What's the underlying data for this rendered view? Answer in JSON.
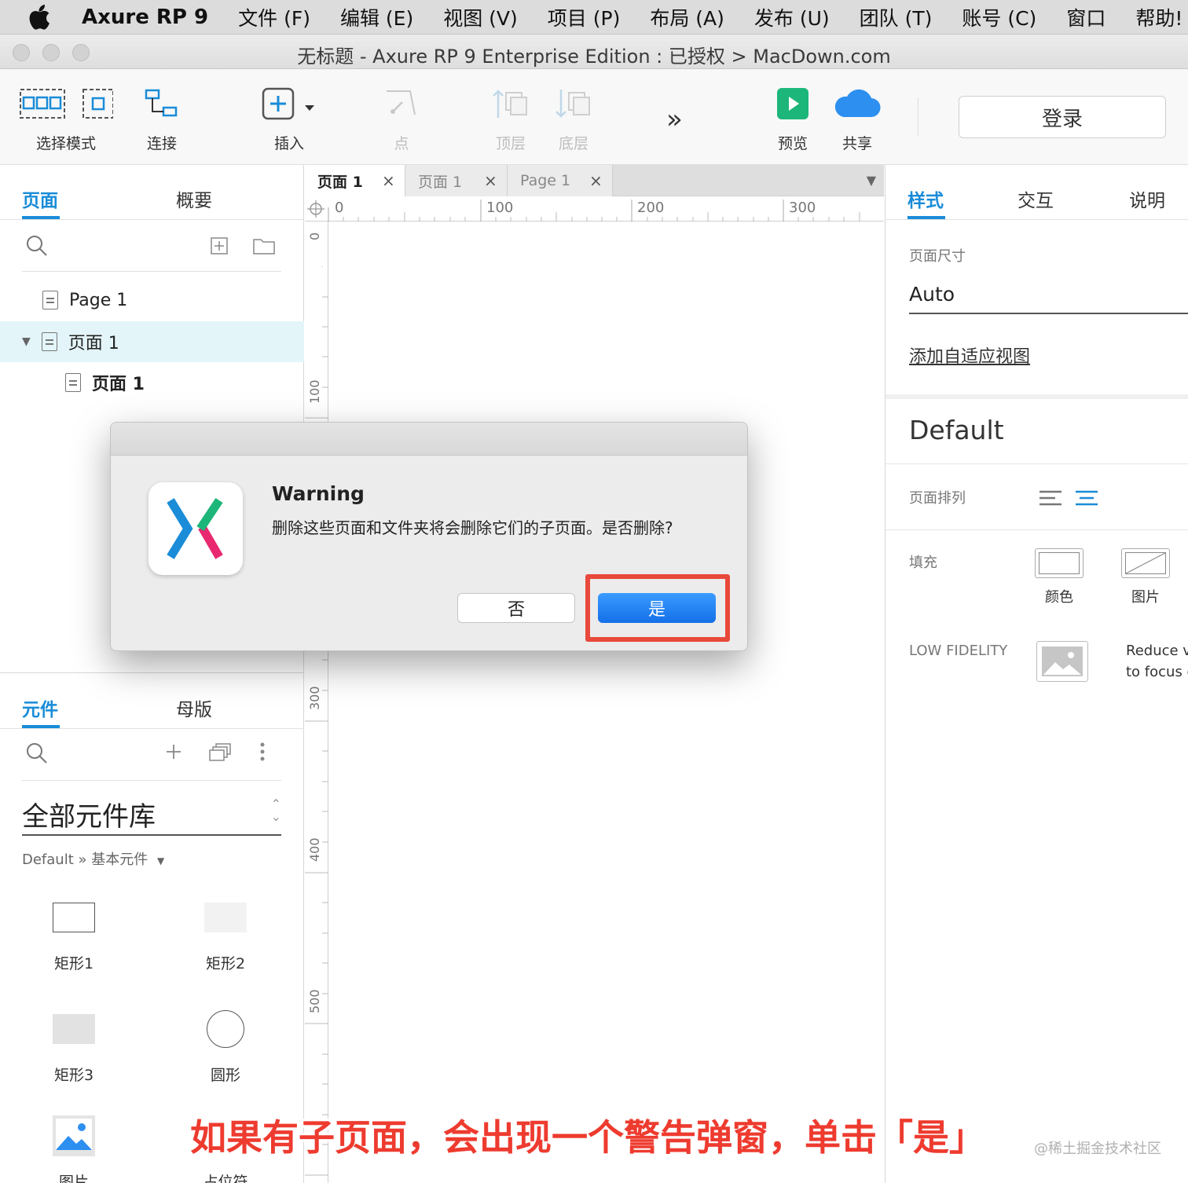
{
  "menubar": {
    "app_name": "Axure RP 9",
    "items": [
      "文件 (F)",
      "编辑 (E)",
      "视图 (V)",
      "项目 (P)",
      "布局 (A)",
      "发布 (U)",
      "团队 (T)",
      "账号 (C)",
      "窗口",
      "帮助!"
    ]
  },
  "window": {
    "title": "无标题 - Axure RP 9 Enterprise Edition : 已授权 > MacDown.com"
  },
  "toolbar": {
    "select_mode": "选择模式",
    "connect": "连接",
    "insert": "插入",
    "point": "点",
    "top_layer": "顶层",
    "bottom_layer": "底层",
    "more": "»",
    "preview": "预览",
    "share": "共享",
    "login": "登录"
  },
  "pages_panel": {
    "tab_pages": "页面",
    "tab_outline": "概要",
    "items": [
      {
        "label": "Page 1"
      },
      {
        "label": "页面 1"
      },
      {
        "label": "页面 1"
      }
    ]
  },
  "widgets_panel": {
    "tab_widgets": "元件",
    "tab_masters": "母版",
    "library": "全部元件库",
    "crumb": "Default » 基本元件",
    "items": [
      "矩形1",
      "矩形2",
      "矩形3",
      "圆形",
      "图片",
      "占位符"
    ]
  },
  "doc_tabs": [
    "页面 1",
    "页面 1",
    "Page 1"
  ],
  "ruler": {
    "h_ticks": [
      "0",
      "100",
      "200",
      "300"
    ],
    "v_ticks": [
      "0",
      "100",
      "300",
      "400",
      "500"
    ]
  },
  "right_panel": {
    "tab_style": "样式",
    "tab_interact": "交互",
    "tab_notes": "说明",
    "page_size_label": "页面尺寸",
    "page_size_value": "Auto",
    "add_adaptive": "添加自适应视图",
    "default_title": "Default",
    "page_align_label": "页面排列",
    "fill_label": "填充",
    "fill_color": "颜色",
    "fill_image": "图片",
    "low_fidelity_label": "LOW FIDELITY",
    "low_fidelity_desc_1": "Reduce v",
    "low_fidelity_desc_2": "to focus c"
  },
  "dialog": {
    "title": "Warning",
    "message": "删除这些页面和文件夹将会删除它们的子页面。是否删除?",
    "no_label": "否",
    "yes_label": "是"
  },
  "caption": "如果有子页面，会出现一个警告弹窗，单击「是」",
  "watermark": "@稀土掘金技术社区",
  "colors": {
    "accent": "#1a8cd8",
    "primary_button": "#1570e8",
    "highlight": "#e8493a",
    "preview_green": "#1db67a",
    "share_blue": "#2d8ff0"
  }
}
